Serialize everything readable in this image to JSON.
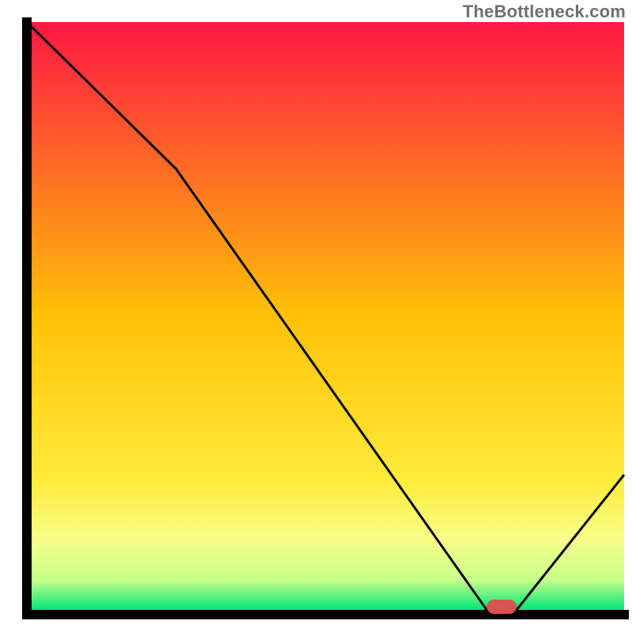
{
  "watermark": {
    "text": "TheBottleneck.com"
  },
  "chart_data": {
    "type": "line",
    "title": "",
    "xlabel": "",
    "ylabel": "",
    "xlim": [
      0,
      100
    ],
    "ylim": [
      0,
      100
    ],
    "x": [
      0,
      25,
      77,
      82,
      100
    ],
    "values": [
      100,
      75,
      0,
      0,
      23
    ],
    "marker": {
      "x_start": 77,
      "x_end": 82,
      "y": 0
    },
    "gradient_stops": [
      {
        "offset": 0.0,
        "color": "#ff1744"
      },
      {
        "offset": 0.5,
        "color": "#ffc107"
      },
      {
        "offset": 0.78,
        "color": "#ffeb3b"
      },
      {
        "offset": 0.88,
        "color": "#f6ff8a"
      },
      {
        "offset": 0.95,
        "color": "#c6ff8a"
      },
      {
        "offset": 1.0,
        "color": "#00e676"
      }
    ],
    "marker_color": "#d9534f",
    "axis_color": "#000000",
    "line_color": "#000000"
  }
}
